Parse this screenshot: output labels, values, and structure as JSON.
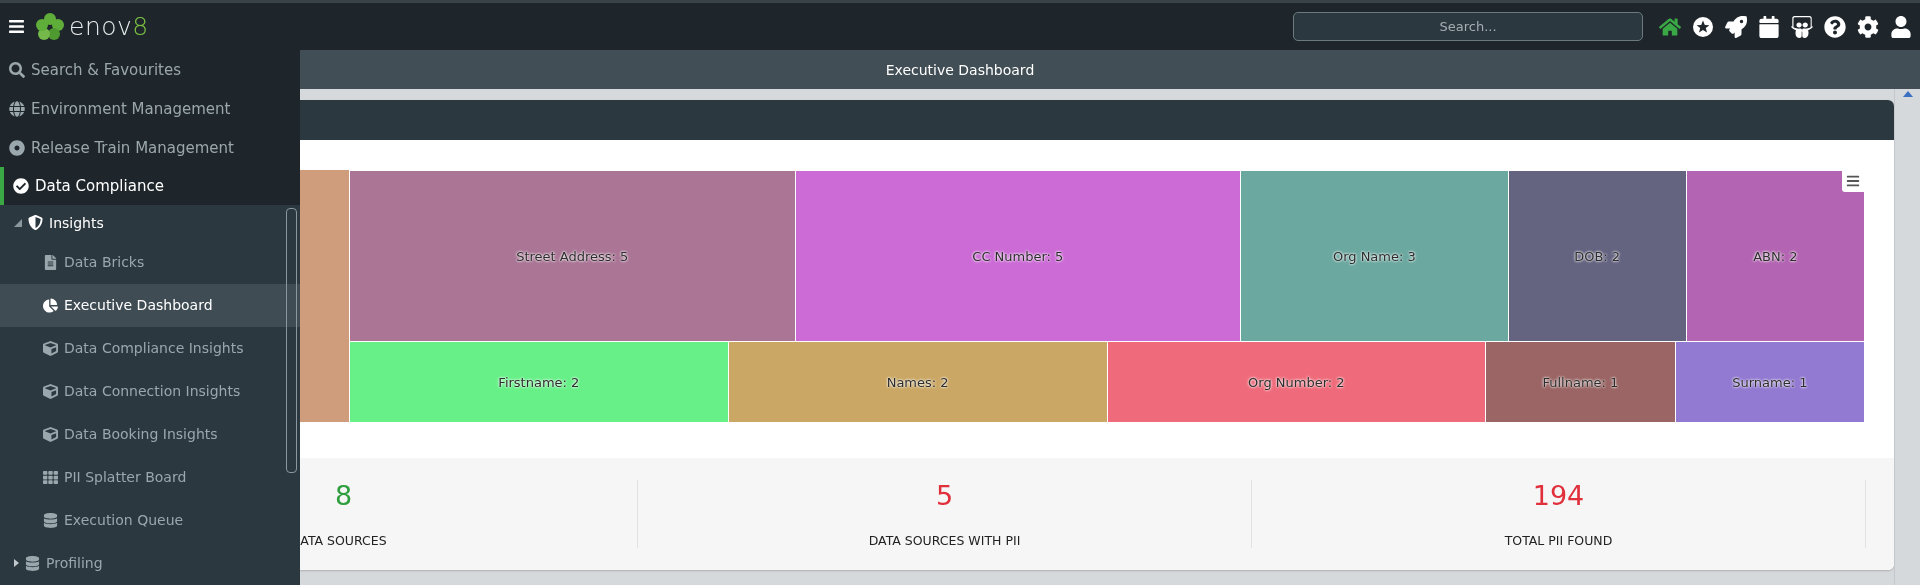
{
  "top_bar": {
    "logo": {
      "text": "enov",
      "accent": "8"
    },
    "search": {
      "placeholder": "Search..."
    }
  },
  "page_title": "Executive Dashboard",
  "sidebar": {
    "items": [
      {
        "label": "Search & Favourites",
        "selected": false
      },
      {
        "label": "Environment Management",
        "selected": false
      },
      {
        "label": "Release Train Management",
        "selected": false
      },
      {
        "label": "Data Compliance",
        "selected": true,
        "expanded": true,
        "children": [
          {
            "label": "Insights",
            "selected": false,
            "expanded": true,
            "children": [
              {
                "label": "Data Bricks",
                "selected": false
              },
              {
                "label": "Executive Dashboard",
                "selected": true
              },
              {
                "label": "Data Compliance Insights",
                "selected": false
              },
              {
                "label": "Data Connection Insights",
                "selected": false
              },
              {
                "label": "Data Booking Insights",
                "selected": false
              },
              {
                "label": "PII Splatter Board",
                "selected": false
              },
              {
                "label": "Execution Queue",
                "selected": false
              }
            ]
          },
          {
            "label": "Profiling",
            "selected": false,
            "expanded": false
          }
        ]
      }
    ]
  },
  "treemap": {
    "side_tile": {
      "color": "#cf9d7b"
    },
    "rows": [
      [
        {
          "label": "Street Address: 5",
          "color": "#ab7596"
        },
        {
          "label": "CC Number: 5",
          "color": "#cc6bd6"
        },
        {
          "label": "Org Name: 3",
          "color": "#6ba8a0"
        },
        {
          "label": "DOB: 2",
          "color": "#646380"
        },
        {
          "label": "ABN: 2",
          "color": "#b364b2"
        }
      ],
      [
        {
          "label": "Firstname: 2",
          "color": "#67f088"
        },
        {
          "label": "Names: 2",
          "color": "#caa764"
        },
        {
          "label": "Org Number: 2",
          "color": "#ef6b7b"
        },
        {
          "label": "Fullname: 1",
          "color": "#9a6564"
        },
        {
          "label": "Surname: 1",
          "color": "#9279d1"
        }
      ]
    ]
  },
  "stats": [
    {
      "value": "8",
      "label": "ATA SOURCES",
      "color": "#2e9e3e"
    },
    {
      "value": "5",
      "label": "DATA SOURCES WITH PII",
      "color": "#e0303c"
    },
    {
      "value": "194",
      "label": "TOTAL PII FOUND",
      "color": "#e0303c"
    }
  ]
}
